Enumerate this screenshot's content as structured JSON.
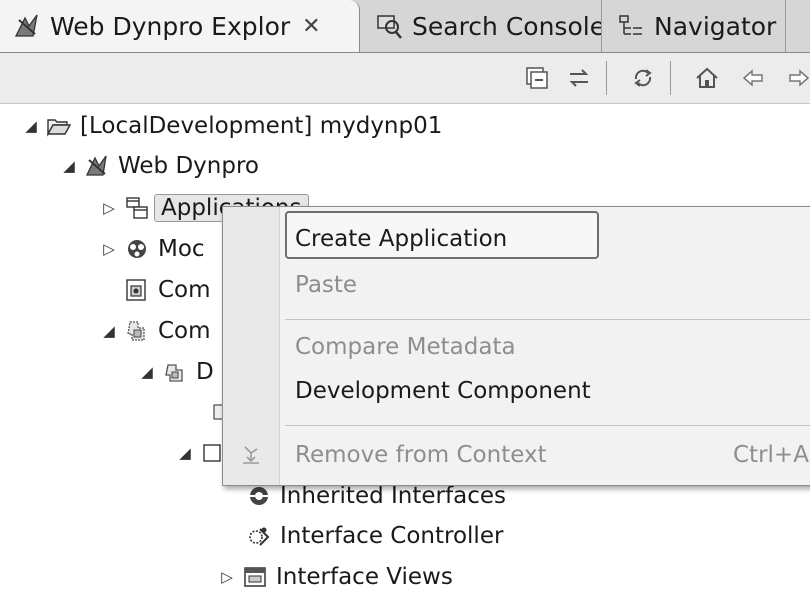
{
  "tabs": [
    {
      "label": "Web Dynpro Explor",
      "icon": "web-dynpro-icon",
      "active": true,
      "close": "✕"
    },
    {
      "label": "Search Console",
      "icon": "search-console-icon"
    },
    {
      "label": "Navigator",
      "icon": "navigator-icon"
    }
  ],
  "toolbar": {
    "icons": [
      "collapse-all-icon",
      "link-with-editor-icon",
      "refresh-icon",
      "home-icon",
      "back-icon",
      "forward-icon"
    ]
  },
  "tree": {
    "project": "[LocalDevelopment] mydynp01",
    "web_dynpro": "Web Dynpro",
    "applications": "Applications",
    "models_partial": "Moc",
    "com1_partial": "Com",
    "com2_partial": "Com",
    "d_partial": "D",
    "inherited_interfaces": "Inherited Interfaces",
    "interface_controller": "Interface Controller",
    "interface_views": "Interface Views"
  },
  "context_menu": {
    "items": [
      {
        "label": "Create Application",
        "enabled": true,
        "hovered": true
      },
      {
        "label": "Paste",
        "enabled": false
      },
      {
        "label": "Compare Metadata",
        "enabled": false
      },
      {
        "label": "Development Component",
        "enabled": true
      },
      {
        "label": "Remove from Context",
        "enabled": false,
        "shortcut": "Ctrl+A"
      }
    ]
  },
  "colors": {
    "tab_bar": "#d6d6d6",
    "active_tab": "#f4f4f4",
    "menu_bg": "#f2f2f2",
    "disabled_text": "#8e8e8e",
    "icon_gray": "#555555"
  }
}
